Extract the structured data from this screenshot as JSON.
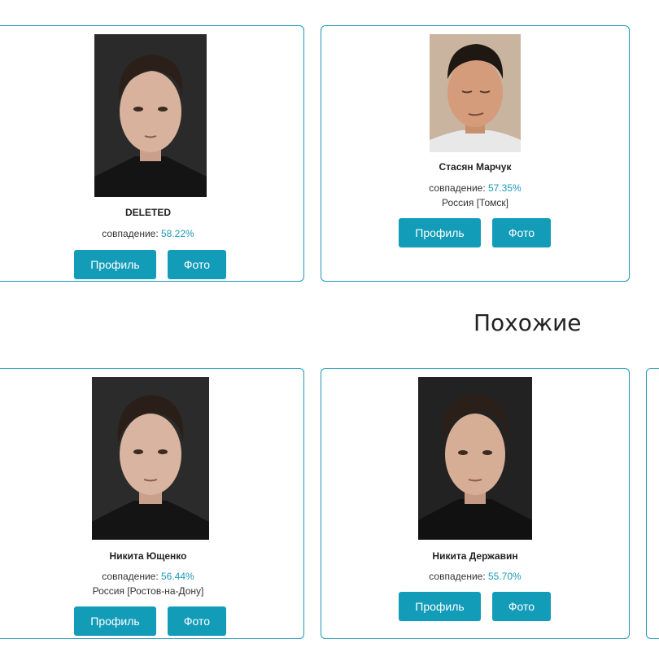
{
  "matches": [
    {
      "name": "DELETED",
      "match_label": "совпадение:",
      "match_value": "58.22%",
      "location": "",
      "profile_label": "Профиль",
      "photo_label": "Фото"
    },
    {
      "name": "Стасян Марчук",
      "match_label": "совпадение:",
      "match_value": "57.35%",
      "location": "Россия [Томск]",
      "profile_label": "Профиль",
      "photo_label": "Фото"
    }
  ],
  "section_title": "Похожие",
  "similar": [
    {
      "name": "Никита Ющенко",
      "match_label": "совпадение:",
      "match_value": "56.44%",
      "location": "Россия [Ростов-на-Дону]",
      "profile_label": "Профиль",
      "photo_label": "Фото"
    },
    {
      "name": "Никита Державин",
      "match_label": "совпадение:",
      "match_value": "55.70%",
      "location": "",
      "profile_label": "Профиль",
      "photo_label": "Фото"
    }
  ],
  "colors": {
    "accent": "#139cb8",
    "border": "#1e9ab7",
    "percent": "#1e9ab7"
  }
}
